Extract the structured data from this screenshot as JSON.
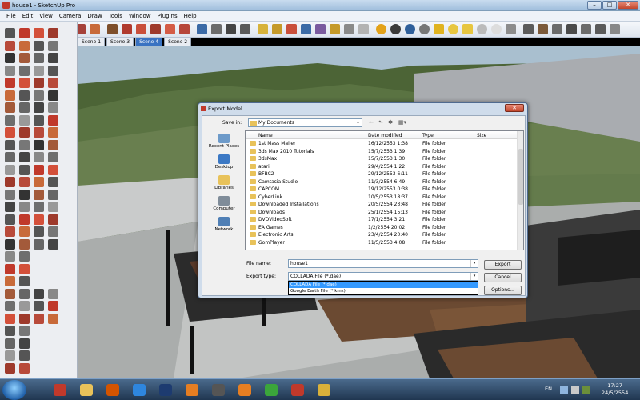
{
  "window": {
    "title": "house1 - SketchUp Pro",
    "min": "–",
    "max": "□",
    "close": "✕"
  },
  "menu": [
    "File",
    "Edit",
    "View",
    "Camera",
    "Draw",
    "Tools",
    "Window",
    "Plugins",
    "Help"
  ],
  "scenes": {
    "tabs": [
      "Scene 1",
      "Scene 3",
      "Scene 4",
      "Scene 2"
    ],
    "active": "Scene 4"
  },
  "dialog": {
    "title": "Export Model",
    "close": "✕",
    "save_in_label": "Save in:",
    "save_in_value": "My Documents",
    "save_in_arrow": "▾",
    "nav": {
      "back": "←",
      "up": "⬑",
      "new_folder": "✱",
      "view": "▦▾"
    },
    "places": [
      {
        "label": "Recent Places",
        "icon": "recent-places-icon"
      },
      {
        "label": "Desktop",
        "icon": "desktop-icon"
      },
      {
        "label": "Libraries",
        "icon": "libraries-icon"
      },
      {
        "label": "Computer",
        "icon": "computer-icon"
      },
      {
        "label": "Network",
        "icon": "network-icon"
      }
    ],
    "columns": [
      "Name",
      "Date modified",
      "Type",
      "Size"
    ],
    "files": [
      {
        "name": "1st Mass Mailer",
        "date": "16/12/2553 1:38",
        "type": "File folder"
      },
      {
        "name": "3ds Max 2010 Tutorials",
        "date": "15/7/2553 1:39",
        "type": "File folder"
      },
      {
        "name": "3dsMax",
        "date": "15/7/2553 1:30",
        "type": "File folder"
      },
      {
        "name": "atari",
        "date": "29/4/2554 1:22",
        "type": "File folder"
      },
      {
        "name": "BFBC2",
        "date": "29/12/2553 6:11",
        "type": "File folder"
      },
      {
        "name": "Camtasia Studio",
        "date": "11/3/2554 6:49",
        "type": "File folder"
      },
      {
        "name": "CAPCOM",
        "date": "19/12/2553 0:38",
        "type": "File folder"
      },
      {
        "name": "CyberLink",
        "date": "10/5/2553 18:37",
        "type": "File folder"
      },
      {
        "name": "Downloaded Installations",
        "date": "20/5/2554 23:48",
        "type": "File folder"
      },
      {
        "name": "Downloads",
        "date": "25/1/2554 15:13",
        "type": "File folder"
      },
      {
        "name": "DVDVideoSoft",
        "date": "17/1/2554 3:21",
        "type": "File folder"
      },
      {
        "name": "EA Games",
        "date": "1/2/2554 20:02",
        "type": "File folder"
      },
      {
        "name": "Electronic Arts",
        "date": "23/4/2554 20:40",
        "type": "File folder"
      },
      {
        "name": "GomPlayer",
        "date": "11/5/2553 4:08",
        "type": "File folder"
      }
    ],
    "file_name_label": "File name:",
    "file_name_value": "house1",
    "export_type_label": "Export type:",
    "export_type_value": "COLLADA File (*.dae)",
    "export_type_options": [
      "COLLADA File (*.dae)",
      "Google Earth File (*.kmz)"
    ],
    "combo_arrow": "▾",
    "buttons": {
      "export": "Export",
      "cancel": "Cancel",
      "options": "Options..."
    }
  },
  "taskbar": {
    "apps": [
      "sketchup-icon",
      "explorer-icon",
      "powerpoint-icon",
      "chrome-icon",
      "photoshop-icon",
      "media-player-icon",
      "microphone-icon",
      "firefox-icon",
      "messenger-icon",
      "sketchup-icon",
      "sketchup-style-icon"
    ],
    "language": "EN",
    "time": "17:27",
    "date": "24/5/2554"
  },
  "colors": {
    "accent": "#3a73c2",
    "selection": "#3399ff",
    "folder": "#e8c25a"
  }
}
